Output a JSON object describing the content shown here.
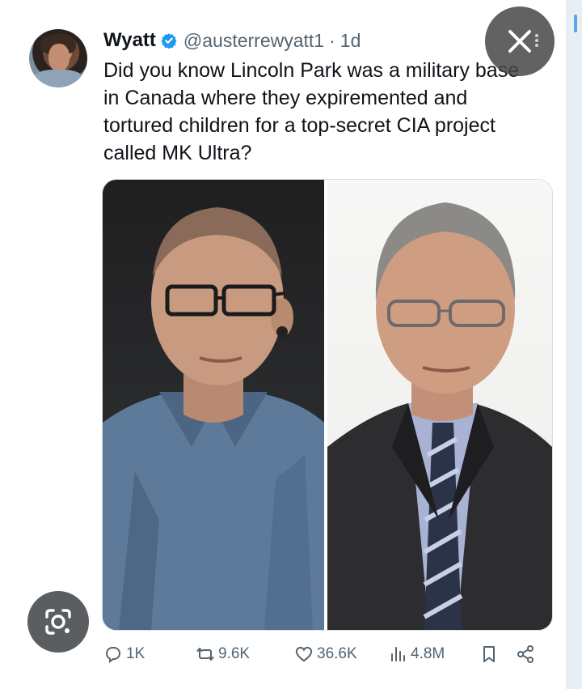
{
  "tweet": {
    "author_name": "Wyatt",
    "handle": "@austerrewyatt1",
    "separator": "·",
    "time": "1d",
    "text": "Did you know Lincoln Park was a military base in Canada where they expiremented and tortured children for a top-secret CIA project called MK Ultra?"
  },
  "actions": {
    "replies": "1K",
    "reposts": "9.6K",
    "likes": "36.6K",
    "views": "4.8M"
  },
  "icons": {
    "verified": "verified-badge-icon",
    "close": "close-icon",
    "reply": "reply-icon",
    "repost": "repost-icon",
    "like": "heart-icon",
    "views": "views-chart-icon",
    "bookmark": "bookmark-icon",
    "share": "share-icon",
    "lens": "google-lens-icon"
  },
  "colors": {
    "verified_blue": "#1d9bf0",
    "text": "#0f1419",
    "muted": "#536471"
  }
}
